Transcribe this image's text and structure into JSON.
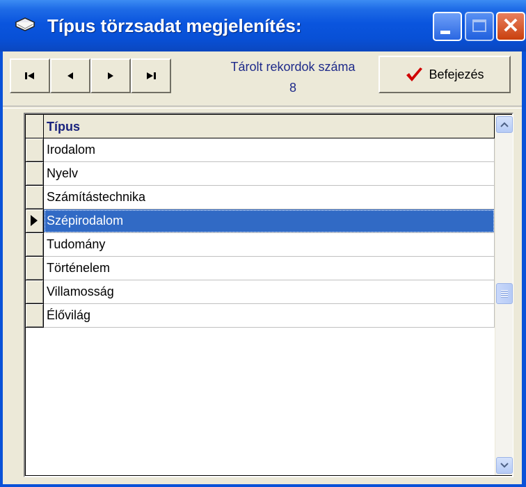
{
  "window": {
    "title": "Típus törzsadat megjelenítés:",
    "controls": [
      "minimize",
      "maximize",
      "close"
    ],
    "close_glyph": "✕"
  },
  "toolbar": {
    "nav_buttons": [
      {
        "name": "first-record",
        "icon": "first-record-icon"
      },
      {
        "name": "prev-record",
        "icon": "prev-record-icon"
      },
      {
        "name": "next-record",
        "icon": "next-record-icon"
      },
      {
        "name": "last-record",
        "icon": "last-record-icon"
      }
    ],
    "records_label": "Tárolt rekordok száma",
    "records_count": "8",
    "finish_label": "Befejezés",
    "finish_icon": "checkmark-icon"
  },
  "grid": {
    "column_header": "Típus",
    "rows": [
      "Irodalom",
      "Nyelv",
      "Számítástechnika",
      "Szépirodalom",
      "Tudomány",
      "Történelem",
      "Villamosság",
      "Élővilág"
    ],
    "selected_index": 3
  },
  "colors": {
    "selection": "#316AC5",
    "title_bar": "#0A55DE",
    "label_text": "#1E2A8A",
    "checkmark": "#D00000"
  }
}
